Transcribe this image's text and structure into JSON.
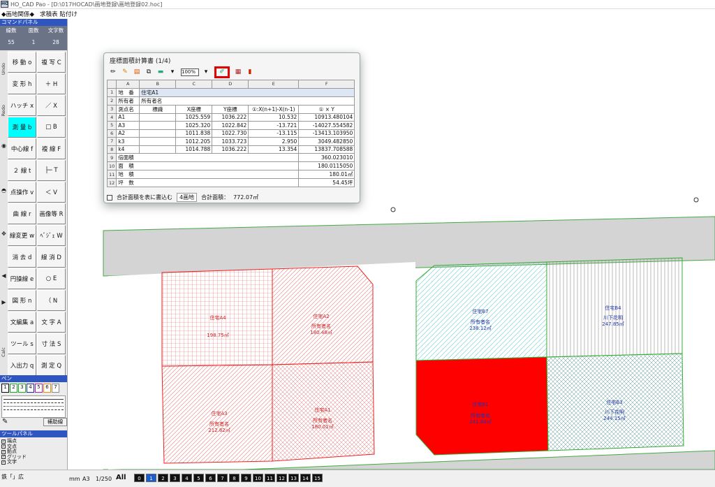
{
  "window": {
    "title": "HO_CAD Pao - [D:\\017HOCAD\\画地登録\\画地登録02.hoc]",
    "menu": [
      "◆画地関係◆",
      "求積表 貼付け"
    ]
  },
  "command_panel": {
    "header": "コマンドパネル",
    "stats": [
      {
        "label": "線数",
        "value": "55"
      },
      {
        "label": "面数",
        "value": "1"
      },
      {
        "label": "文字数",
        "value": "28"
      }
    ]
  },
  "sidebar_tabs": [
    "Undo",
    "Redo",
    "Calc"
  ],
  "commands": [
    {
      "label": "移 動 o",
      "active": false
    },
    {
      "label": "複 写 C",
      "active": false
    },
    {
      "label": "変 形 h",
      "active": false
    },
    {
      "label": "＋ H",
      "active": false
    },
    {
      "label": "ハッチ x",
      "active": false
    },
    {
      "label": "／ X",
      "active": false
    },
    {
      "label": "測 量 b",
      "active": true
    },
    {
      "label": "□ B",
      "active": false
    },
    {
      "label": "中心線 f",
      "active": false
    },
    {
      "label": "複 線 F",
      "active": false
    },
    {
      "label": "２ 線 t",
      "active": false
    },
    {
      "label": "├─ T",
      "active": false
    },
    {
      "label": "点操作 v",
      "active": false
    },
    {
      "label": "＜ V",
      "active": false
    },
    {
      "label": "曲 線 r",
      "active": false
    },
    {
      "label": "画像等 R",
      "active": false
    },
    {
      "label": "線変更 w",
      "active": false
    },
    {
      "label": "ﾍﾞｼﾞｪ W",
      "active": false
    },
    {
      "label": "消 去 d",
      "active": false
    },
    {
      "label": "線 消 D",
      "active": false
    },
    {
      "label": "円操線 e",
      "active": false
    },
    {
      "label": "○ E",
      "active": false
    },
    {
      "label": "図 形 n",
      "active": false
    },
    {
      "label": "（ N",
      "active": false
    },
    {
      "label": "文編集 a",
      "active": false
    },
    {
      "label": "文 字 A",
      "active": false
    },
    {
      "label": "ツール s",
      "active": false
    },
    {
      "label": "寸 法 S",
      "active": false
    },
    {
      "label": "入出力 q",
      "active": false
    },
    {
      "label": "測 定 Q",
      "active": false
    }
  ],
  "pen": {
    "header": "ペン",
    "numbers": [
      "1",
      "2",
      "3",
      "4",
      "5",
      "6",
      "7"
    ],
    "hoshi_label": "補助線"
  },
  "tool_panel": {
    "header": "ツールパネル",
    "checks": [
      "端点",
      "交点",
      "鉛点",
      "グリッド",
      "文字"
    ]
  },
  "status": {
    "left": "鉄「」広",
    "unit": "mm",
    "paper": "A3",
    "scale": "1/250",
    "all_label": "All",
    "layers": [
      "0",
      "1",
      "2",
      "3",
      "4",
      "5",
      "6",
      "7",
      "8",
      "9",
      "10",
      "11",
      "12",
      "13",
      "14",
      "15"
    ],
    "selected_layer": "1"
  },
  "dialog": {
    "title": "座標面積計算書 (1/4)",
    "zoom": "100%",
    "columns": [
      "A",
      "B",
      "C",
      "D",
      "E",
      "F"
    ],
    "rows": [
      {
        "n": "1",
        "cells": [
          "地　番",
          "住宅A1",
          "",
          "",
          "",
          ""
        ]
      },
      {
        "n": "2",
        "cells": [
          "所有者",
          "所有者名",
          "",
          "",
          "",
          ""
        ]
      },
      {
        "n": "3",
        "cells": [
          "測点名",
          "標識",
          "X座標",
          "Y座標",
          "①:X(n+1)-X(n-1)",
          "① × Y"
        ]
      },
      {
        "n": "4",
        "cells": [
          "A1",
          "",
          "1025.559",
          "1036.222",
          "10.532",
          "10913.480104"
        ]
      },
      {
        "n": "5",
        "cells": [
          "A3",
          "",
          "1025.320",
          "1022.842",
          "-13.721",
          "-14027.554582"
        ]
      },
      {
        "n": "6",
        "cells": [
          "A2",
          "",
          "1011.838",
          "1022.730",
          "-13.115",
          "-13413.103950"
        ]
      },
      {
        "n": "7",
        "cells": [
          "k3",
          "",
          "1012.205",
          "1033.723",
          "2.950",
          "3049.482850"
        ]
      },
      {
        "n": "8",
        "cells": [
          "k4",
          "",
          "1014.788",
          "1036.222",
          "13.354",
          "13837.708588"
        ]
      },
      {
        "n": "9",
        "cells": [
          "倍面積",
          "",
          "",
          "",
          "",
          "360.023010"
        ]
      },
      {
        "n": "10",
        "cells": [
          "面　積",
          "",
          "",
          "",
          "",
          "180.0115050"
        ]
      },
      {
        "n": "11",
        "cells": [
          "地　積",
          "",
          "",
          "",
          "",
          "180.01㎡"
        ]
      },
      {
        "n": "12",
        "cells": [
          "坪　数",
          "",
          "",
          "",
          "",
          "54.45坪"
        ]
      }
    ],
    "footer": {
      "checkbox": "合計面積を表に書込む",
      "field": "4画地",
      "total_label": "合計面積：",
      "total_value": "772.07㎡"
    }
  },
  "parcels": [
    {
      "name": "住宅A4",
      "owner": "",
      "area": "198.75㎡"
    },
    {
      "name": "住宅A2",
      "owner": "所有者名",
      "area": "180.48㎡"
    },
    {
      "name": "住宅A3",
      "owner": "所有者名",
      "area": "212.82㎡"
    },
    {
      "name": "住宅A1",
      "owner": "所有者名",
      "area": "180.01㎡"
    },
    {
      "name": "住宅B7",
      "owner": "所有者名",
      "area": "238.12㎡"
    },
    {
      "name": "住宅B4",
      "owner": "川下花明",
      "area": "247.85㎡"
    },
    {
      "name": "住宅B1",
      "owner": "所有者名",
      "area": "241.84㎡"
    },
    {
      "name": "住宅B3",
      "owner": "川下花明",
      "area": "244.15㎡"
    }
  ],
  "colors": {
    "accent": "#2f55c0",
    "active_cmd": "#00ffff",
    "parcel_red": "#e00000",
    "road": "#d4d4d4",
    "highlight": "#e00000"
  }
}
